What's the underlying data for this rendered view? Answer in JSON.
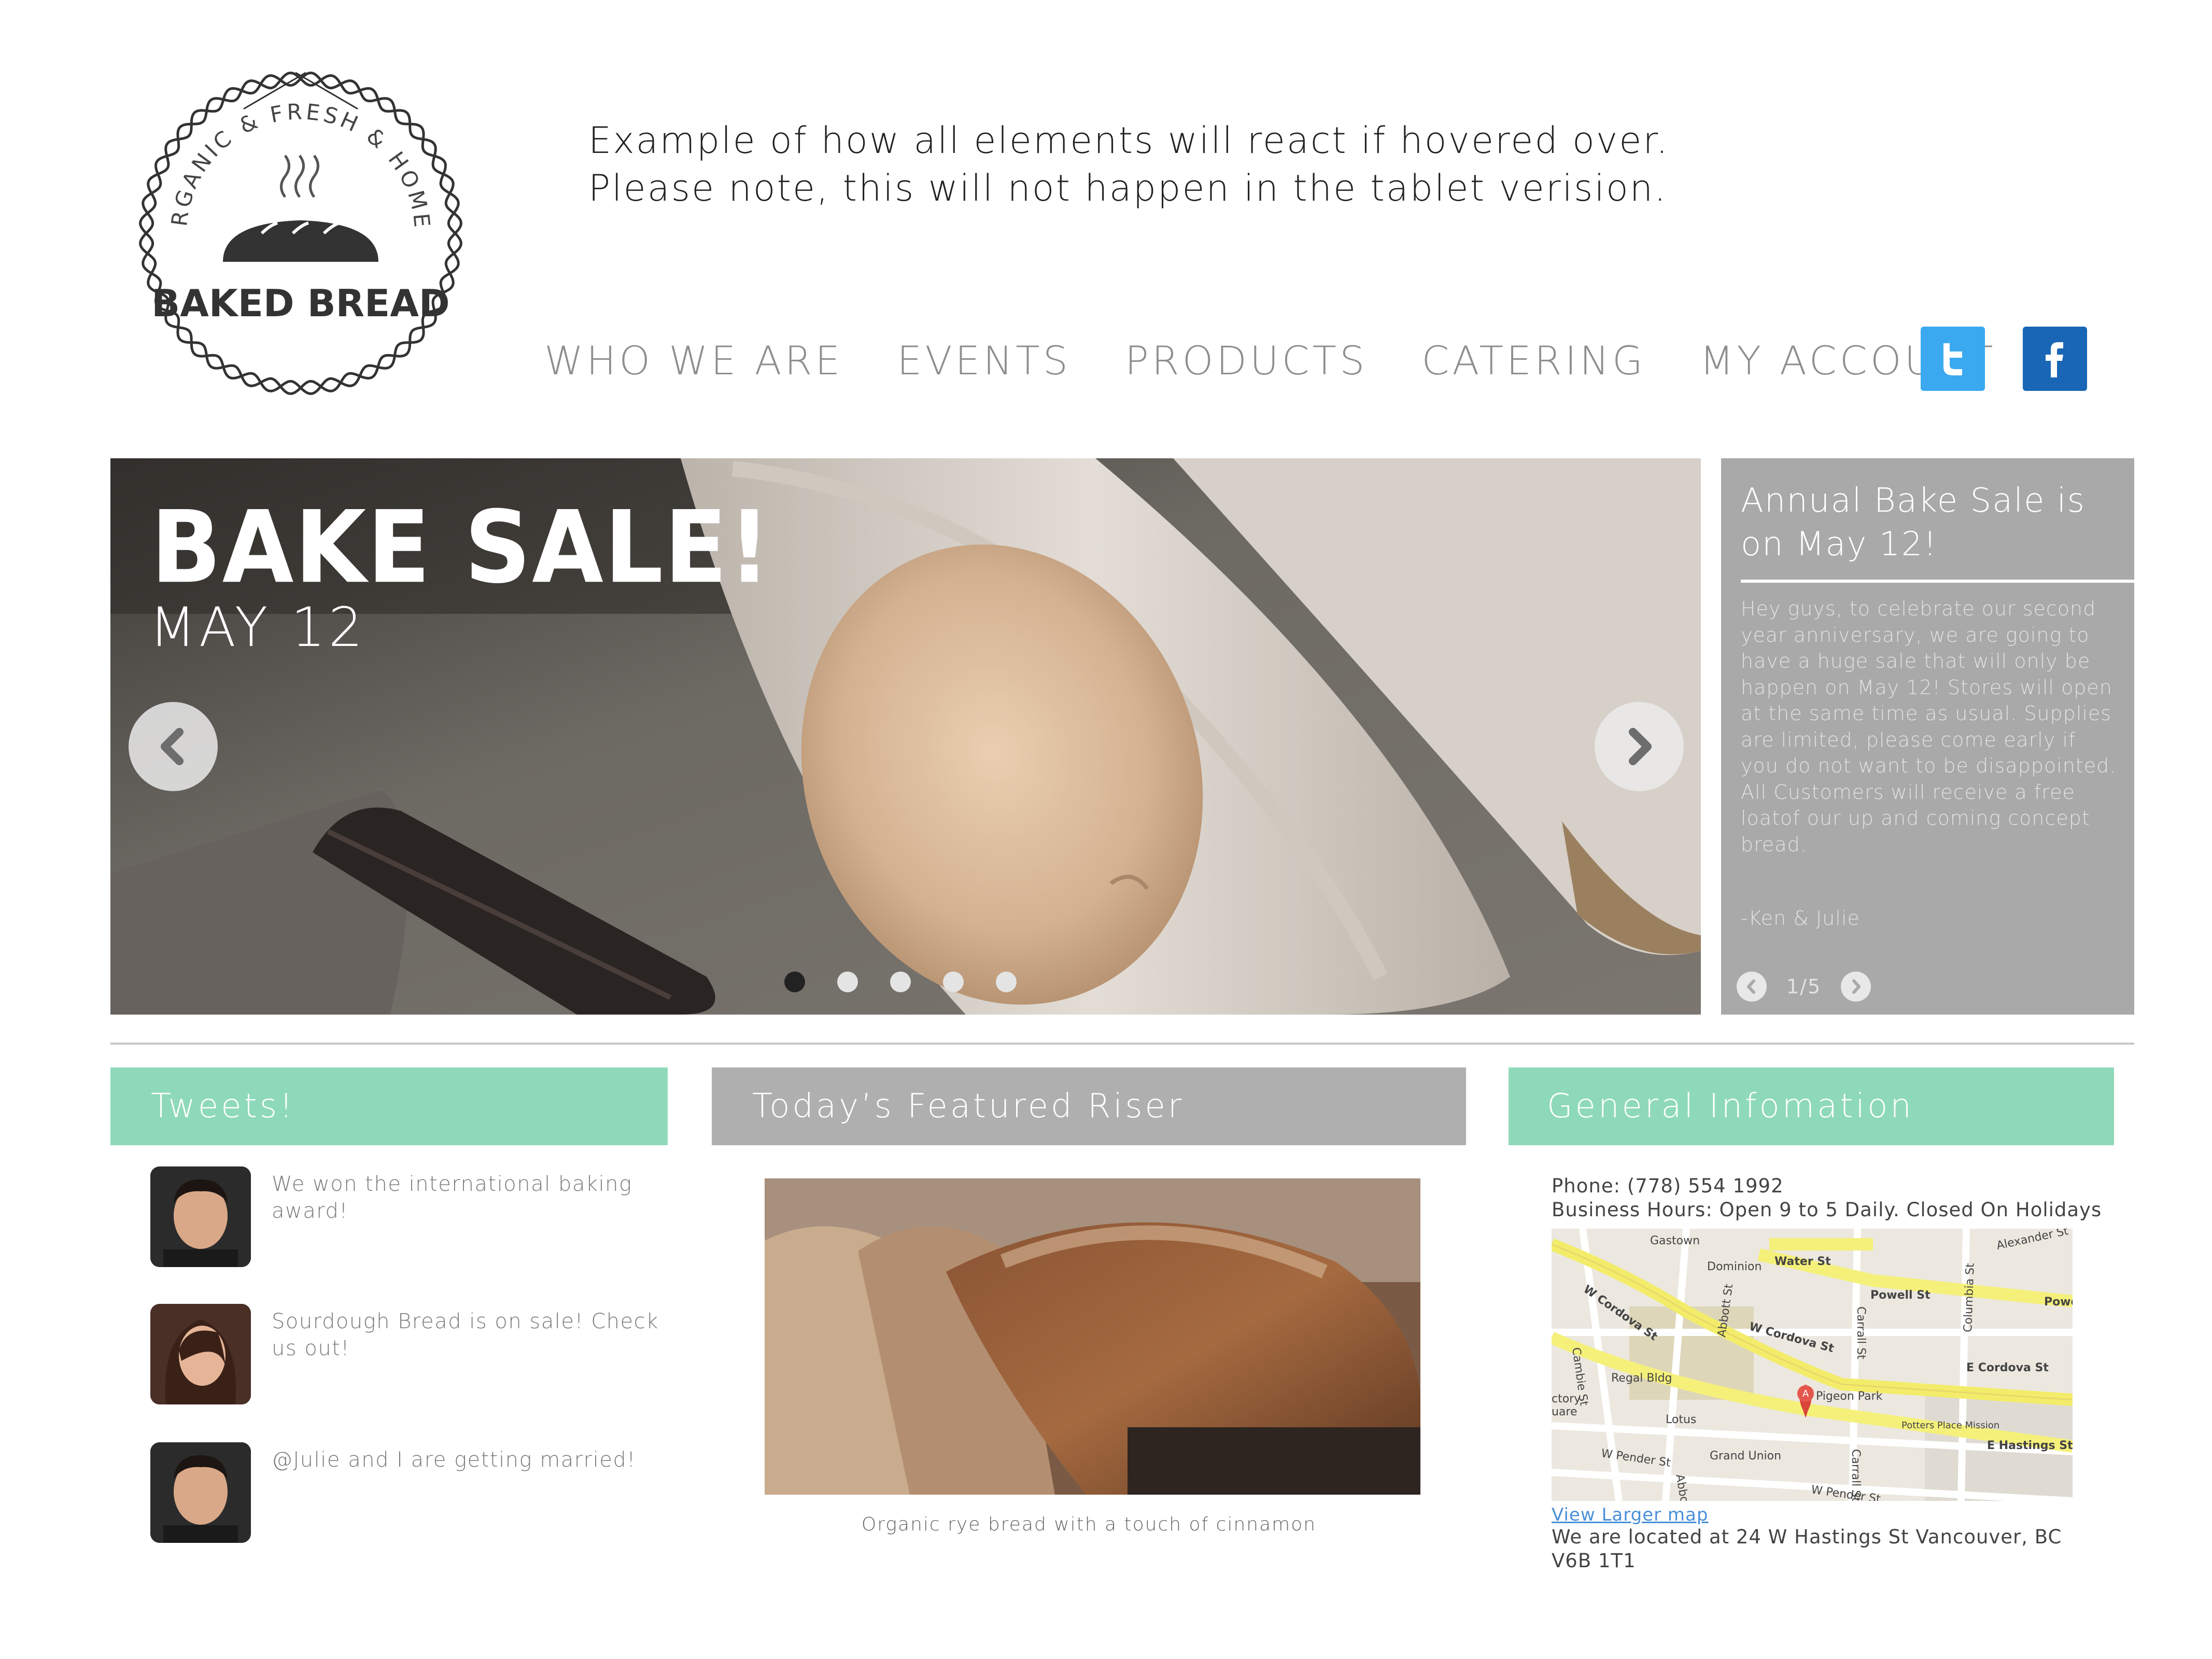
{
  "logo": {
    "arc_text": "ORGANIC & FRESH & HOMEY",
    "name": "BAKED BREAD"
  },
  "notice": {
    "line1": "Example of how all elements will react if hovered over.",
    "line2": "Please note, this will not happen in the tablet verision."
  },
  "nav": {
    "items": [
      "WHO WE ARE",
      "EVENTS",
      "PRODUCTS",
      "CATERING",
      "MY ACCOUNT"
    ]
  },
  "social": {
    "twitter_icon": "twitter-icon",
    "facebook_icon": "facebook-icon",
    "twitter_color": "#3aa9f0",
    "facebook_color": "#1866b5"
  },
  "hero": {
    "title": "BAKE SALE!",
    "date": "MAY 12",
    "slide_count": 5,
    "active_slide": 1
  },
  "panel": {
    "title": "Annual Bake Sale is on May 12!",
    "body": "Hey guys, to celebrate our second year anniversary, we are going to have a huge sale that will only be happen on May 12! Stores will open at the same time as usual. Supplies are limited, please come early if you do not want to be disappointed. All Customers will receive a free loatof our up and coming concept bread.",
    "signature": "-Ken & Julie",
    "pager": "1/5"
  },
  "sections": {
    "tweets": "Tweets!",
    "featured": "Today’s Featured Riser",
    "info": "General Infomation"
  },
  "tweets": [
    {
      "text": "We won the international baking award!"
    },
    {
      "text": "Sourdough Bread is on sale! Check us out!"
    },
    {
      "text": "@Julie and I are getting married!"
    }
  ],
  "featured": {
    "caption": "Organic rye bread with a touch of cinnamon"
  },
  "info": {
    "phone": "Phone: (778) 554 1992",
    "hours": "Business Hours: Open 9 to 5 Daily. Closed On Holidays",
    "map_link": "View Larger map",
    "address": "We are located at 24 W Hastings St  Vancouver, BC V6B 1T1"
  },
  "map": {
    "labels": [
      "Gastown",
      "Water St",
      "Dominion",
      "W Cordova St",
      "Powell St",
      "Alexander St",
      "Powe",
      "Abbott St",
      "Carrall St",
      "W Cordova St",
      "E Cordova St",
      "Cambie St",
      "Regal Bldg",
      "Pigeon Park",
      "Columbia St",
      "Lotus",
      "Potters Place Mission",
      "E Hastings St",
      "W Pender St",
      "Grand Union",
      "W Pender St",
      "Abbo",
      "Carrall St",
      "ctory",
      "uare"
    ]
  },
  "colors": {
    "accent_green": "#8ed9b9",
    "panel_gray": "#a9a9a9",
    "featured_gray": "#afafaf"
  }
}
